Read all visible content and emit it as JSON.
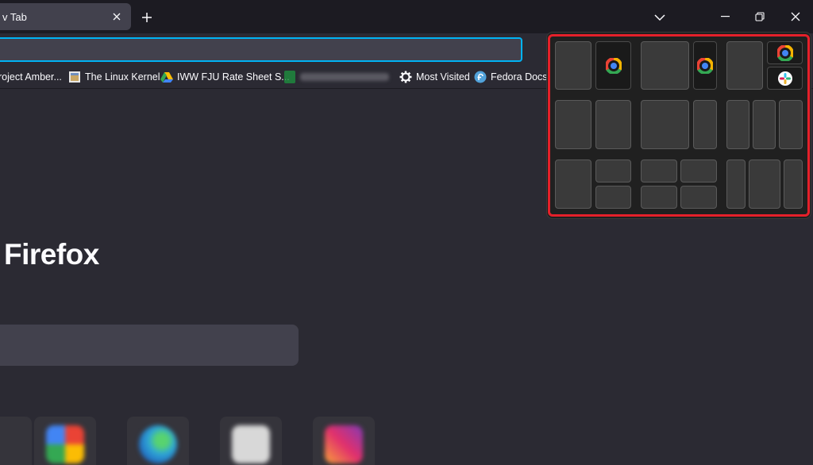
{
  "tabs": [
    {
      "title": "v Tab",
      "close_icon": "close-icon"
    }
  ],
  "tabstrip": {
    "new_tab_icon": "plus-icon",
    "list_all_tabs_icon": "chevron-down-icon"
  },
  "window_controls": [
    "minimize-icon",
    "restore-icon",
    "close-icon"
  ],
  "bookmarks": [
    {
      "label": "roject Amber...",
      "icon": "bookmark-icon"
    },
    {
      "label": "The Linux Kernel",
      "icon": "linux-kernel-icon"
    },
    {
      "label": "IWW FJU Rate Sheet S...",
      "icon": "google-drive-icon"
    },
    {
      "label": "",
      "icon": "spreadsheet-icon",
      "blurred": true
    },
    {
      "label": "Most Visited",
      "icon": "gear-icon"
    },
    {
      "label": "Fedora Docs",
      "icon": "fedora-icon"
    }
  ],
  "page": {
    "brand_text": "Firefox"
  },
  "shortcut_tiles": [
    {
      "name": "google-photos-icon",
      "color": "#e5a23a"
    },
    {
      "name": "edge-icon",
      "color": "#2fa8d6"
    },
    {
      "name": "generic-site-icon",
      "color": "#d8d8d8"
    },
    {
      "name": "instagram-icon",
      "color": "#d6479a"
    }
  ],
  "snap_layouts": {
    "layouts": [
      {
        "name": "two-halves",
        "zones": [
          {
            "occupied": false
          },
          {
            "occupied": true,
            "icon": "chrome-canary-icon"
          }
        ]
      },
      {
        "name": "wide-left-narrow-right",
        "zones": [
          {
            "occupied": false
          },
          {
            "occupied": true,
            "icon": "chrome-canary-icon"
          }
        ]
      },
      {
        "name": "left-plus-two-stacked-right",
        "zones": [
          {
            "occupied": false
          },
          {
            "occupied": true,
            "icon": "chrome-canary-icon"
          },
          {
            "occupied": true,
            "icon": "slack-icon"
          }
        ]
      },
      {
        "name": "two-halves-empty",
        "zones": []
      },
      {
        "name": "wide-left-narrow-right-empty",
        "zones": []
      },
      {
        "name": "three-columns",
        "zones": []
      },
      {
        "name": "left-plus-two-stacked-right-empty",
        "zones": []
      },
      {
        "name": "four-quadrants",
        "zones": []
      },
      {
        "name": "three-columns-wide-center",
        "zones": []
      }
    ],
    "highlight_color": "#e5202a"
  }
}
